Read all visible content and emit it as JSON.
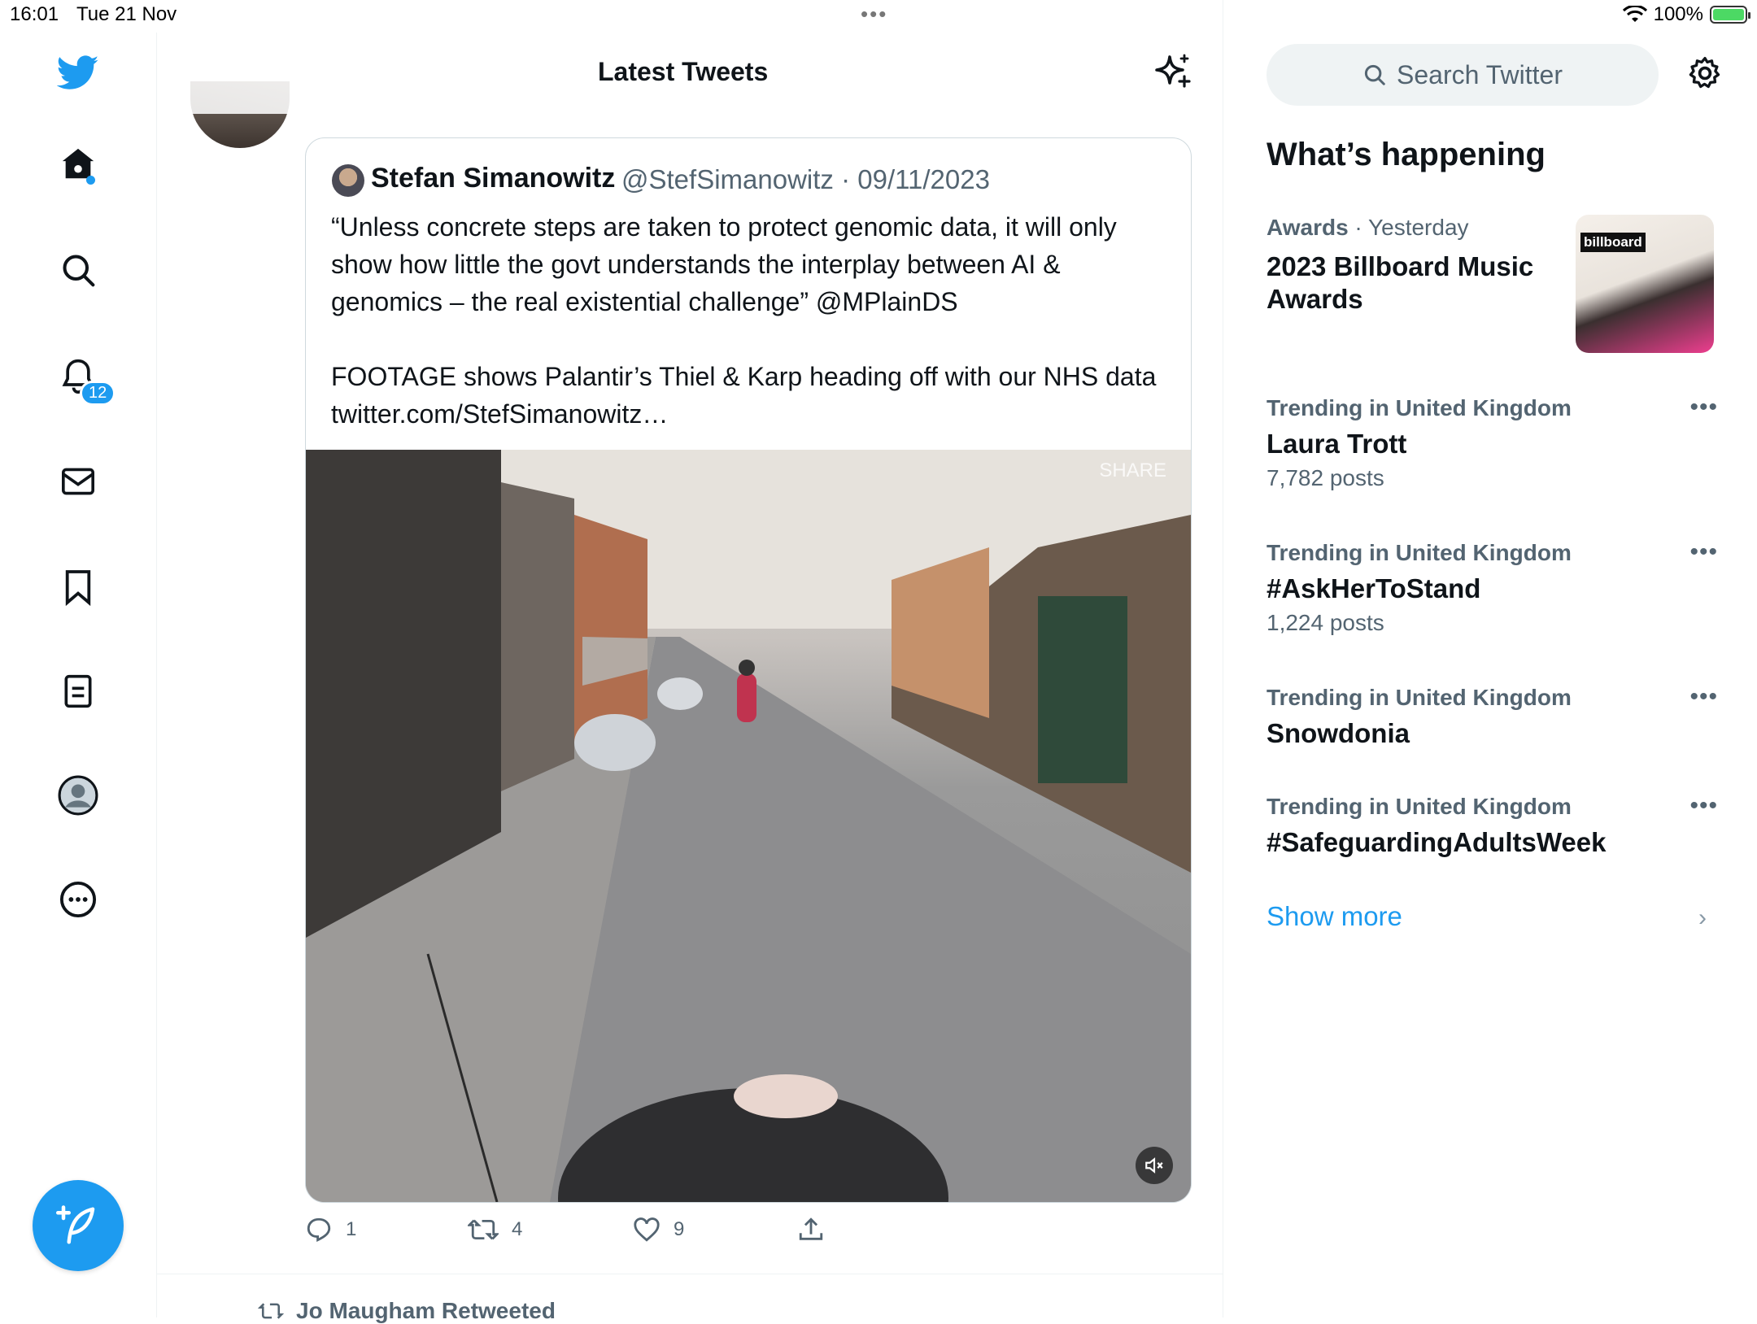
{
  "status": {
    "time": "16:01",
    "date": "Tue 21 Nov",
    "battery": "100%"
  },
  "nav": {
    "notifications_badge": "12"
  },
  "header": {
    "title": "Latest Tweets"
  },
  "tweet": {
    "quoted": {
      "name": "Stefan Simanowitz",
      "handle_date": "@StefSimanowitz · 09/11/2023",
      "text": "“Unless concrete steps are taken to protect genomic data, it will only show how little the govt understands the interplay between AI & genomics – the real existential challenge” @MPlainDS\n\nFOOTAGE shows Palantir’s Thiel & Karp heading off with our NHS data twitter.com/StefSimanowitz…",
      "video_overlay": "SHARE"
    },
    "actions": {
      "replies": "1",
      "retweets": "4",
      "likes": "9"
    },
    "next_retweeted": "Jo Maugham Retweeted"
  },
  "sidebar": {
    "search_placeholder": "Search Twitter",
    "whats_happening": "What’s happening",
    "featured": {
      "category": "Awards",
      "time": "· Yesterday",
      "title": "2023 Billboard Music Awards",
      "thumb_label": "billboard"
    },
    "trends": [
      {
        "category": "Trending in United Kingdom",
        "name": "Laura Trott",
        "posts": "7,782 posts"
      },
      {
        "category": "Trending in United Kingdom",
        "name": "#AskHerToStand",
        "posts": "1,224 posts"
      },
      {
        "category": "Trending in United Kingdom",
        "name": "Snowdonia",
        "posts": ""
      },
      {
        "category": "Trending in United Kingdom",
        "name": "#SafeguardingAdultsWeek",
        "posts": ""
      }
    ],
    "show_more": "Show more"
  },
  "colors": {
    "accent": "#1d9bf0",
    "text": "#0f1419",
    "muted": "#536471"
  }
}
